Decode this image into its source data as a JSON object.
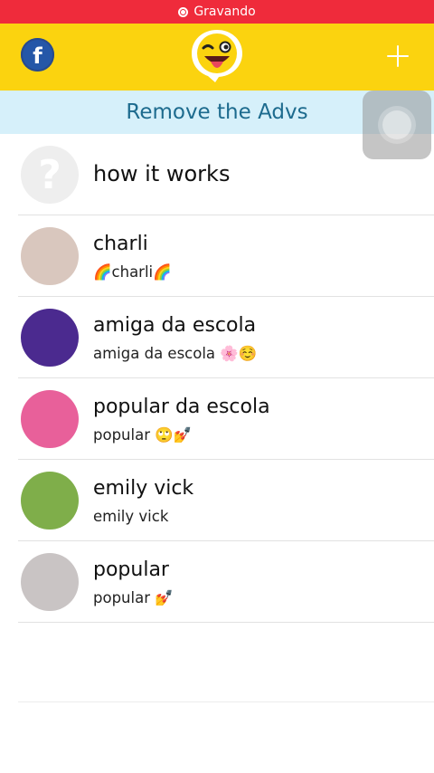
{
  "status_bar": {
    "recording_label": "Gravando"
  },
  "header": {
    "facebook_icon_glyph": "f",
    "colors": {
      "header_bg": "#fbd30f",
      "rec_bg": "#ef2b3b",
      "banner_bg": "#d6f0fa",
      "banner_text": "#1d6b8e"
    }
  },
  "banner": {
    "label": "Remove the Advs"
  },
  "how_it_works": {
    "icon_glyph": "?",
    "label": "how it works"
  },
  "contacts": [
    {
      "name": "charli",
      "subtitle": "🌈charli🌈",
      "avatar_color": "#d9c7be"
    },
    {
      "name": "amiga da escola",
      "subtitle": "amiga da escola 🌸☺️",
      "avatar_color": "#4b2a8f"
    },
    {
      "name": "popular da escola",
      "subtitle": "popular 🙄💅",
      "avatar_color": "#e8609a"
    },
    {
      "name": "emily vick",
      "subtitle": "emily vick",
      "avatar_color": "#7fae4a"
    },
    {
      "name": "popular",
      "subtitle": "popular 💅",
      "avatar_color": "#c9c4c4"
    }
  ]
}
